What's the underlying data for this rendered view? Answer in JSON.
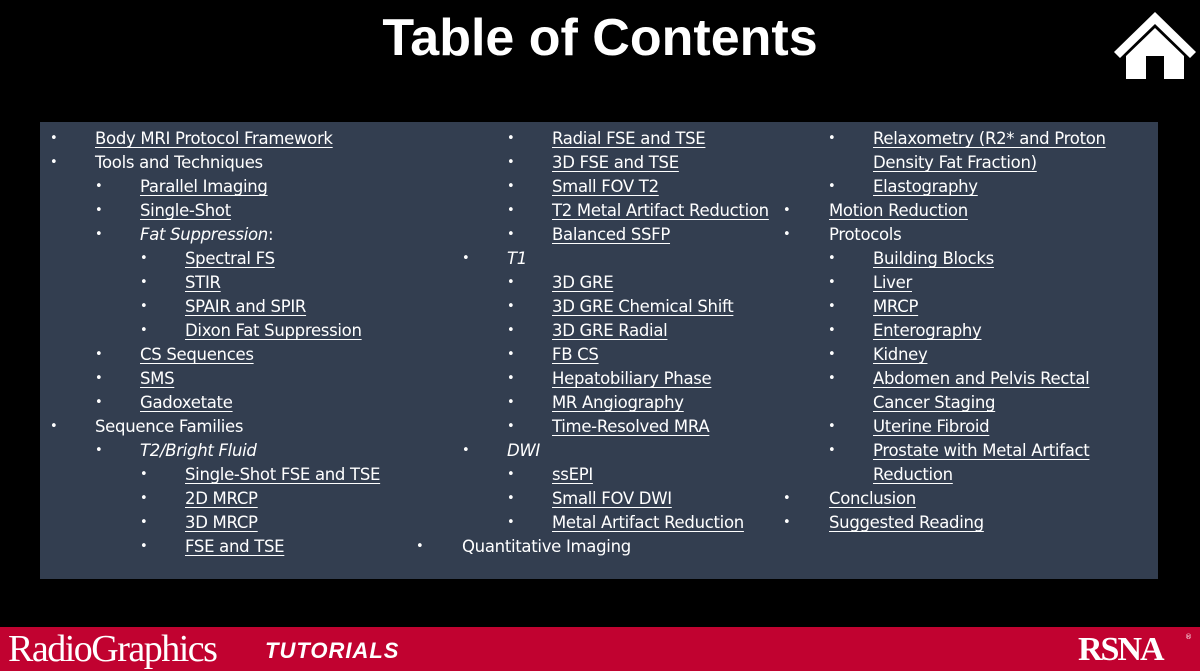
{
  "header": {
    "title": "Table of Contents",
    "home_icon": "home-icon"
  },
  "toc": {
    "column1": [
      {
        "bullet": "•",
        "label": "Body MRI Protocol Framework",
        "level": 1,
        "link": true
      },
      {
        "bullet": "•",
        "label": "Tools and Techniques",
        "level": 1,
        "link": false
      },
      {
        "bullet": "•",
        "label": "Parallel Imaging",
        "level": 2,
        "link": true
      },
      {
        "bullet": "•",
        "label": "Single-Shot",
        "level": 2,
        "link": true
      },
      {
        "bullet": "•",
        "label": "Fat Suppression",
        "suffix": ":",
        "level": 2,
        "link": false,
        "italic": true
      },
      {
        "bullet": "•",
        "label": "Spectral FS",
        "level": 3,
        "link": true
      },
      {
        "bullet": "•",
        "label": "STIR",
        "level": 3,
        "link": true
      },
      {
        "bullet": "•",
        "label": "SPAIR and SPIR",
        "level": 3,
        "link": true
      },
      {
        "bullet": "•",
        "label": "Dixon Fat Suppression",
        "level": 3,
        "link": true
      },
      {
        "bullet": "•",
        "label": "CS Sequences",
        "level": 2,
        "link": true
      },
      {
        "bullet": "•",
        "label": "SMS",
        "level": 2,
        "link": true
      },
      {
        "bullet": "•",
        "label": "Gadoxetate",
        "level": 2,
        "link": true
      },
      {
        "bullet": "•",
        "label": "Sequence Families",
        "level": 1,
        "link": false
      },
      {
        "bullet": "•",
        "label": "T2/Bright Fluid",
        "level": 2,
        "link": false,
        "italic": true
      },
      {
        "bullet": "•",
        "label": "Single-Shot FSE and TSE",
        "level": 3,
        "link": true
      },
      {
        "bullet": "•",
        "label": "2D MRCP",
        "level": 3,
        "link": true
      },
      {
        "bullet": "•",
        "label": "3D MRCP",
        "level": 3,
        "link": true
      },
      {
        "bullet": "•",
        "label": "FSE and TSE",
        "level": 3,
        "link": true
      }
    ],
    "column2": [
      {
        "bullet": "•",
        "label": "Radial FSE and TSE",
        "level": 3,
        "link": true
      },
      {
        "bullet": "•",
        "label": "3D FSE and TSE",
        "level": 3,
        "link": true
      },
      {
        "bullet": "•",
        "label": "Small FOV T2",
        "level": 3,
        "link": true
      },
      {
        "bullet": "•",
        "label": "T2 Metal Artifact Reduction",
        "level": 3,
        "link": true
      },
      {
        "bullet": "•",
        "label": "Balanced SSFP",
        "level": 3,
        "link": true
      },
      {
        "bullet": "•",
        "label": "T1",
        "level": 2,
        "link": false,
        "italic": true
      },
      {
        "bullet": "•",
        "label": "3D GRE",
        "level": 3,
        "link": true
      },
      {
        "bullet": "•",
        "label": "3D GRE Chemical Shift",
        "level": 3,
        "link": true
      },
      {
        "bullet": "•",
        "label": "3D GRE Radial",
        "level": 3,
        "link": true
      },
      {
        "bullet": "•",
        "label": "FB CS",
        "level": 3,
        "link": true
      },
      {
        "bullet": "•",
        "label": "Hepatobiliary Phase",
        "level": 3,
        "link": true
      },
      {
        "bullet": "•",
        "label": "MR Angiography",
        "level": 3,
        "link": true
      },
      {
        "bullet": "•",
        "label": "Time-Resolved MRA",
        "level": 3,
        "link": true
      },
      {
        "bullet": "•",
        "label": "DWI",
        "level": 2,
        "link": false,
        "italic": true
      },
      {
        "bullet": "•",
        "label": "ssEPI",
        "level": 3,
        "link": true
      },
      {
        "bullet": "•",
        "label": "Small FOV DWI",
        "level": 3,
        "link": true
      },
      {
        "bullet": "•",
        "label": "Metal Artifact Reduction",
        "level": 3,
        "link": true
      },
      {
        "bullet": "•",
        "label": "Quantitative Imaging",
        "level": 1,
        "link": false
      }
    ],
    "column3": [
      {
        "bullet": "•",
        "label": "Relaxometry (R2* and Proton Density Fat Fraction)",
        "level": 2,
        "link": true,
        "wrapped": true
      },
      {
        "bullet": "•",
        "label": "Elastography",
        "level": 2,
        "link": true
      },
      {
        "bullet": "•",
        "label": "Motion Reduction",
        "level": 1,
        "link": true
      },
      {
        "bullet": "•",
        "label": "Protocols",
        "level": 1,
        "link": false
      },
      {
        "bullet": "•",
        "label": "Building Blocks",
        "level": 2,
        "link": true
      },
      {
        "bullet": "•",
        "label": "Liver",
        "level": 2,
        "link": true
      },
      {
        "bullet": "•",
        "label": "MRCP",
        "level": 2,
        "link": true
      },
      {
        "bullet": "•",
        "label": "Enterography",
        "level": 2,
        "link": true
      },
      {
        "bullet": "•",
        "label": "Kidney",
        "level": 2,
        "link": true
      },
      {
        "bullet": "•",
        "label": "Abdomen and Pelvis Rectal Cancer Staging",
        "level": 2,
        "link": true,
        "wrapped": true
      },
      {
        "bullet": "•",
        "label": "Uterine Fibroid",
        "level": 2,
        "link": true
      },
      {
        "bullet": "•",
        "label": "Prostate with Metal Artifact Reduction",
        "level": 2,
        "link": true,
        "wrapped": true
      },
      {
        "bullet": "•",
        "label": "Conclusion",
        "level": 1,
        "link": true
      },
      {
        "bullet": "•",
        "label": "Suggested Reading",
        "level": 1,
        "link": true
      }
    ]
  },
  "footer": {
    "brand": "RadioGraphics",
    "series": "TUTORIALS",
    "org_logo": "RSNA",
    "registered": "®"
  },
  "colors": {
    "background": "#000000",
    "panel": "#333e50",
    "text": "#ffffff",
    "footer": "#c10230"
  }
}
